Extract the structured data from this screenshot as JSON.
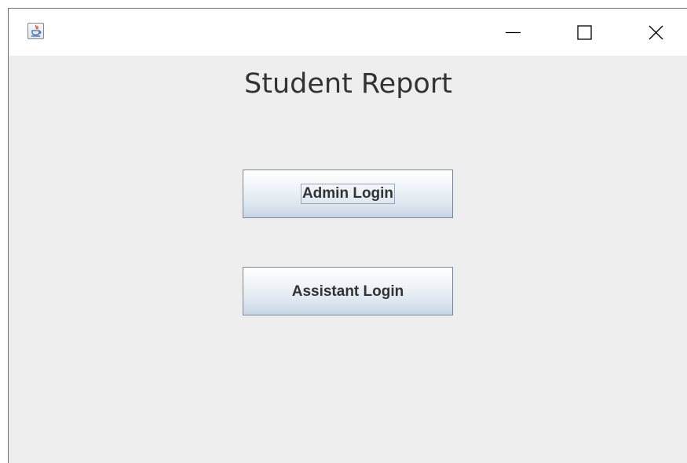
{
  "window": {
    "icon": "java-cup-icon",
    "controls": [
      "minimize-icon",
      "maximize-icon",
      "close-icon"
    ]
  },
  "main": {
    "title": "Student Report",
    "buttons": {
      "admin_login": "Admin Login",
      "assistant_login": "Assistant Login"
    }
  },
  "colors": {
    "window_background": "#eeeeee",
    "titlebar_background": "#ffffff",
    "button_border": "#7a8a99",
    "text": "#333333"
  }
}
